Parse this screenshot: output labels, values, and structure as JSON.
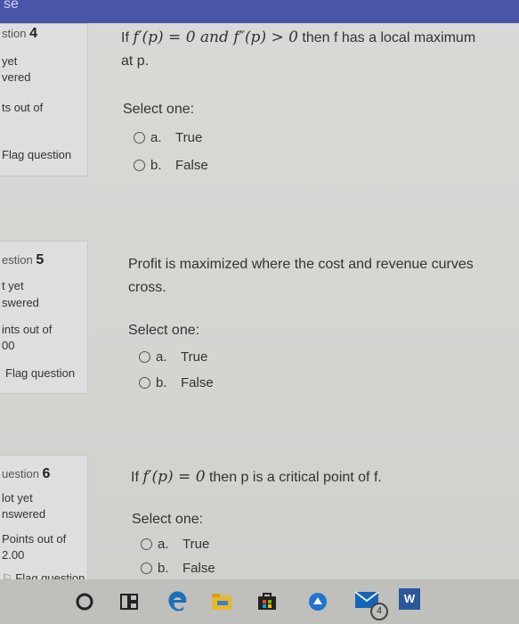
{
  "header": {
    "partial_title": "se"
  },
  "questions": [
    {
      "label_partial": "stion",
      "number": "4",
      "status_lines": [
        "yet",
        "vered"
      ],
      "points_partial": "ts out of",
      "flag_partial": "Flag question",
      "text_pre": "If ",
      "text_math": "f′(p) = 0 and f″(p) > 0",
      "text_post": " then f has a local maximum at p.",
      "select_label": "Select one:",
      "options": [
        {
          "letter": "a.",
          "label": "True"
        },
        {
          "letter": "b.",
          "label": "False"
        }
      ]
    },
    {
      "label_partial": "estion",
      "number": "5",
      "status_lines": [
        "t yet",
        "swered"
      ],
      "points_line1": "ints out of",
      "points_line2": "00",
      "flag_partial": "Flag question",
      "text": "Profit is maximized where the cost and revenue curves cross.",
      "select_label": "Select one:",
      "options": [
        {
          "letter": "a.",
          "label": "True"
        },
        {
          "letter": "b.",
          "label": "False"
        }
      ]
    },
    {
      "label_partial": "uestion",
      "number": "6",
      "status_lines": [
        "lot yet",
        "nswered"
      ],
      "points_line1": "Points out of",
      "points_line2": "2.00",
      "flag_partial": "Flag question",
      "text_pre": "If ",
      "text_math": "f′(p) = 0",
      "text_post": " then p is a critical point of f.",
      "select_label": "Select one:",
      "options": [
        {
          "letter": "a.",
          "label": "True"
        },
        {
          "letter": "b.",
          "label": "False"
        }
      ]
    }
  ],
  "taskbar": {
    "icons": [
      "cortana-icon",
      "task-view-icon",
      "edge-icon",
      "file-explorer-icon",
      "store-icon",
      "app-icon",
      "mail-icon",
      "word-icon"
    ],
    "mail_badge": "4",
    "word_letter": "W"
  }
}
